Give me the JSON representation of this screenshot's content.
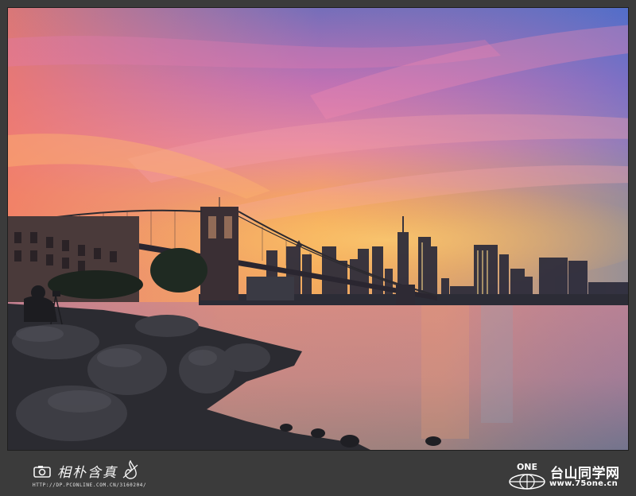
{
  "photo": {
    "subject": "",
    "colors": {
      "sky_top": "#4f6fc4",
      "sky_mid": "#c070b8",
      "sky_horizon": "#f59a45",
      "water": "#b07080",
      "rocks": "#2c2c30"
    }
  },
  "footer": {
    "left_signature": "相朴含真",
    "left_url": "HTTP://DP.PCONLINE.COM.CN/3160204/",
    "right_logo_text": "ONE",
    "right_site_name": "台山同学网",
    "right_site_url": "www.75one.cn",
    "icons": [
      "camera-icon",
      "flame-icon",
      "globe-icon"
    ]
  }
}
